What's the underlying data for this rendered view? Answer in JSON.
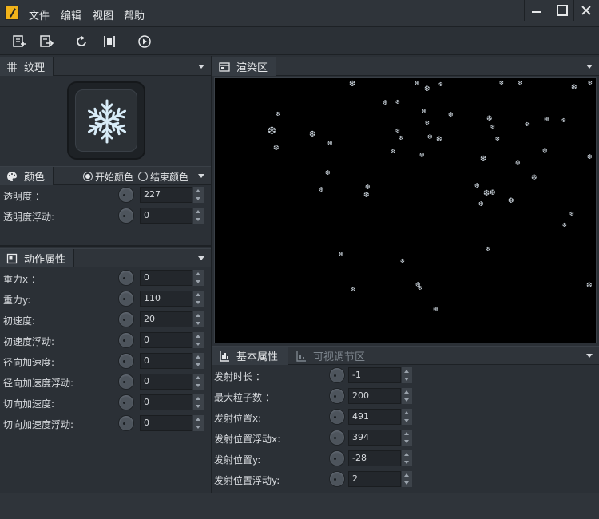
{
  "menu": [
    "文件",
    "编辑",
    "视图",
    "帮助"
  ],
  "toolbar": {
    "buttons": [
      "new-icon",
      "export-icon",
      "refresh-icon",
      "fit-icon",
      "play-icon"
    ]
  },
  "texture_panel": {
    "title": "纹理",
    "preview_icon": "snowflake-icon"
  },
  "color_panel": {
    "title": "颜色",
    "start_color_label": "开始颜色",
    "end_color_label": "结束颜色",
    "selected": "开始颜色",
    "rows": [
      {
        "label": "透明度 ：",
        "value": "227"
      },
      {
        "label": "透明度浮动:",
        "value": "0"
      }
    ]
  },
  "motion_panel": {
    "title": "动作属性",
    "rows": [
      {
        "label": "重力x ：",
        "value": "0"
      },
      {
        "label": "重力y:",
        "value": "110"
      },
      {
        "label": "初速度:",
        "value": "20"
      },
      {
        "label": "初速度浮动:",
        "value": "0"
      },
      {
        "label": "径向加速度:",
        "value": "0"
      },
      {
        "label": "径向加速度浮动:",
        "value": "0"
      },
      {
        "label": "切向加速度:",
        "value": "0"
      },
      {
        "label": "切向加速度浮动:",
        "value": "0"
      }
    ]
  },
  "render_panel": {
    "title": "渲染区"
  },
  "basic_panel": {
    "tab_basic": "基本属性",
    "tab_visual": "可视调节区",
    "rows": [
      {
        "label": "发射时长 ：",
        "value": "-1"
      },
      {
        "label": "最大粒子数 ：",
        "value": "200"
      },
      {
        "label": "发射位置x:",
        "value": "491"
      },
      {
        "label": "发射位置浮动x:",
        "value": "394"
      },
      {
        "label": "发射位置y:",
        "value": "-28"
      },
      {
        "label": "发射位置浮动y:",
        "value": "2"
      }
    ]
  },
  "colors": {
    "accent_logo": "#f2b31a",
    "panel_bg": "#2b3036",
    "render_bg": "#000000",
    "particle": "#c9d2da"
  }
}
